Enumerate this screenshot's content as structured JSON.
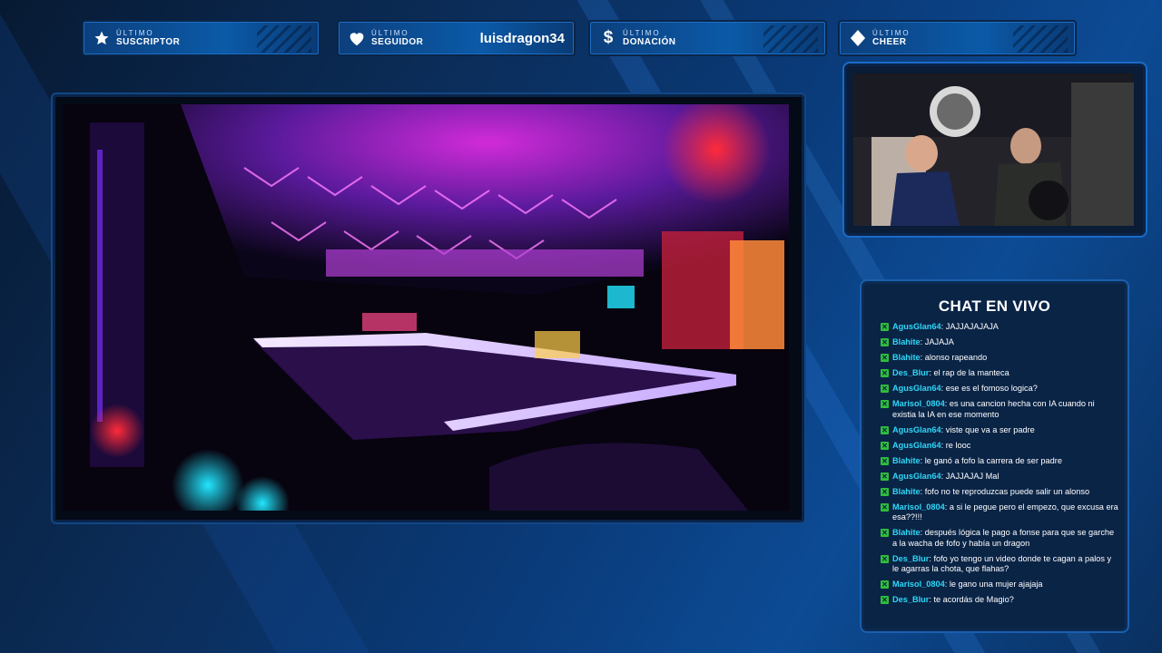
{
  "topbars": [
    {
      "line1": "ÚLTIMO",
      "line2": "SUSCRIPTOR",
      "icon": "star-icon",
      "value": ""
    },
    {
      "line1": "ÚLTIMO",
      "line2": "SEGUIDOR",
      "icon": "heart-icon",
      "value": "luisdragon34"
    },
    {
      "line1": "ÚLTIMO",
      "line2": "DONACIÓN",
      "icon": "dollar-icon",
      "value": ""
    },
    {
      "line1": "ÚLTIMO",
      "line2": "CHEER",
      "icon": "diamond-icon",
      "value": ""
    }
  ],
  "chat": {
    "title": "CHAT EN VIVO",
    "messages": [
      {
        "user": "AgusGlan64",
        "text": "JAJJAJAJAJA"
      },
      {
        "user": "Blahite",
        "text": "JAJAJA"
      },
      {
        "user": "Blahite",
        "text": "alonso rapeando"
      },
      {
        "user": "Des_Blur",
        "text": "el rap de la manteca"
      },
      {
        "user": "AgusGlan64",
        "text": "ese es el fomoso logica?"
      },
      {
        "user": "Marisol_0804",
        "text": "es una cancion hecha con IA cuando ni existia la IA en ese momento"
      },
      {
        "user": "AgusGlan64",
        "text": "viste que va a ser padre"
      },
      {
        "user": "AgusGlan64",
        "text": "re looc"
      },
      {
        "user": "Blahite",
        "text": "le ganó a fofo la carrera de ser padre"
      },
      {
        "user": "AgusGlan64",
        "text": "JAJJAJAJ Mal"
      },
      {
        "user": "Blahite",
        "text": "fofo no te reproduzcas puede salir un alonso"
      },
      {
        "user": "Marisol_0804",
        "text": "a si le pegue pero el empezo, que excusa era esa??!!!"
      },
      {
        "user": "Blahite",
        "text": "después lógica le pago a fonse para que se garche a la wacha de fofo y había un dragon"
      },
      {
        "user": "Des_Blur",
        "text": "fofo yo tengo un video donde te cagan a palos y le agarras la chota, que flahas?"
      },
      {
        "user": "Marisol_0804",
        "text": "le gano una mujer ajajaja"
      },
      {
        "user": "Des_Blur",
        "text": "te acordás de Magio?"
      }
    ]
  },
  "colors": {
    "accent": "#1b6bc7",
    "username": "#2fd7f7",
    "badge": "#2fbf3a"
  }
}
